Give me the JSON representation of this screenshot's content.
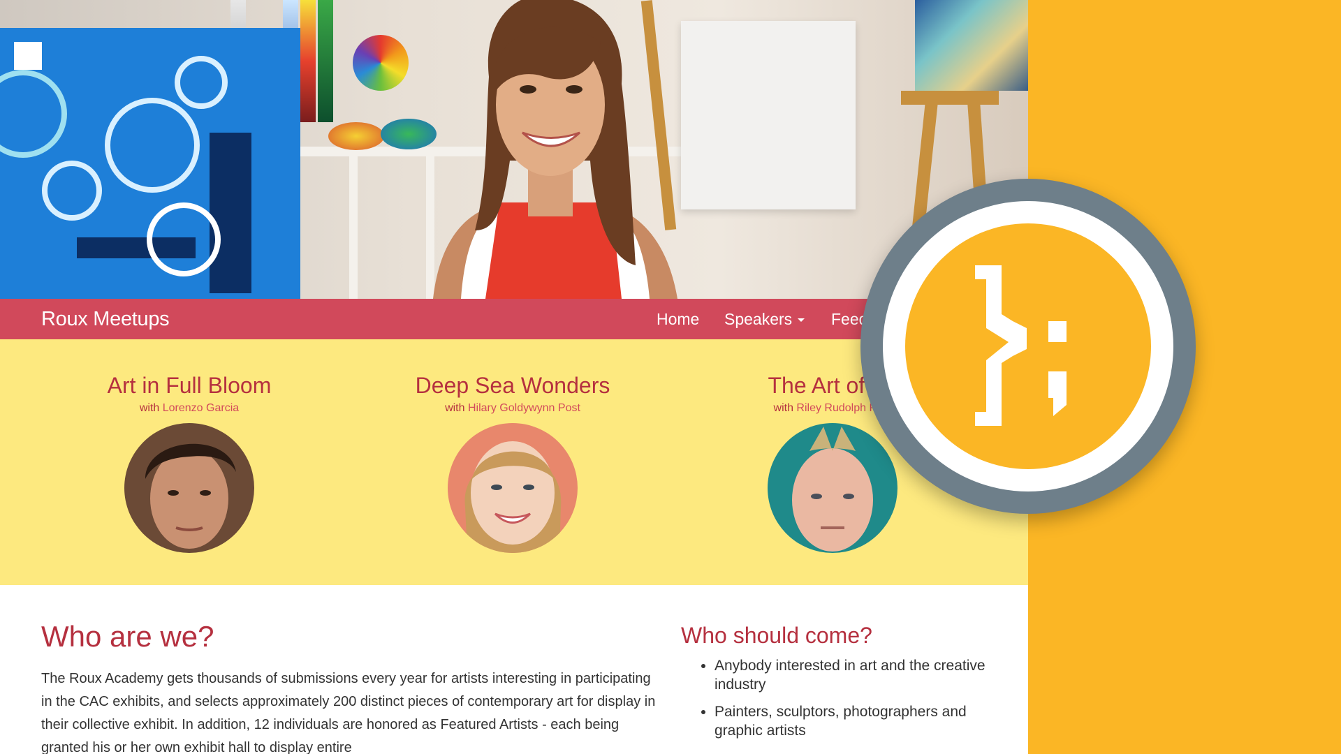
{
  "navbar": {
    "brand": "Roux Meetups",
    "links": [
      {
        "label": "Home"
      },
      {
        "label": "Speakers"
      },
      {
        "label": "Feed"
      }
    ]
  },
  "featured": [
    {
      "title": "Art in Full Bloom",
      "with_label": "with",
      "speaker": "Lorenzo Garcia"
    },
    {
      "title": "Deep Sea Wonders",
      "with_label": "with",
      "speaker": "Hilary Goldywynn Post"
    },
    {
      "title": "The Art of Ab",
      "with_label": "with",
      "speaker": "Riley Rudolph Rew"
    }
  ],
  "who": {
    "title": "Who are we?",
    "text": "The Roux Academy gets thousands of submissions every year for artists interesting in participating in the CAC exhibits, and selects approximately 200 distinct pieces of contemporary art for display in their collective exhibit. In addition, 12 individuals are honored as Featured Artists - each being granted his or her own exhibit hall to display entire"
  },
  "should": {
    "title": "Who should come?",
    "items": [
      "Anybody interested in art and the creative industry",
      "Painters, sculptors, photographers and graphic artists"
    ]
  },
  "colors": {
    "navbar": "#d1495b",
    "featured_bg": "#fde97f",
    "accent_text": "#b5303f",
    "brand_orange": "#fbb625",
    "badge_gray": "#6e7f8a"
  },
  "icons": {
    "logo": "curly-brace-semicolon-logo"
  }
}
